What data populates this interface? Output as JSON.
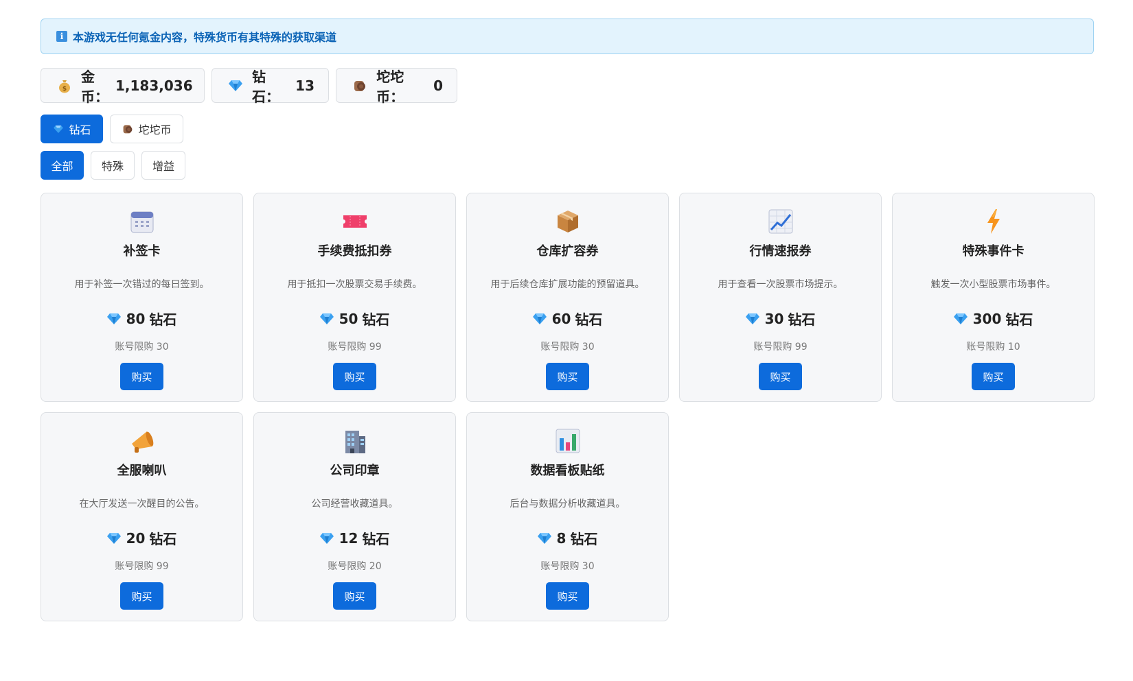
{
  "notice": {
    "text": "本游戏无任何氪金内容，特殊货币有其特殊的获取渠道",
    "icon": "info-icon"
  },
  "balances": [
    {
      "label": "金币：",
      "value": "1,183,036",
      "icon": "money-bag-icon"
    },
    {
      "label": "钻石：",
      "value": "13",
      "icon": "diamond-icon"
    },
    {
      "label": "坨坨币：",
      "value": "0",
      "icon": "tuotuo-coin-icon"
    }
  ],
  "currency_tabs": [
    {
      "label": "钻石",
      "icon": "diamond-icon",
      "active": true
    },
    {
      "label": "坨坨币",
      "icon": "tuotuo-coin-icon",
      "active": false
    }
  ],
  "category_tabs": [
    {
      "label": "全部",
      "active": true
    },
    {
      "label": "特殊",
      "active": false
    },
    {
      "label": "增益",
      "active": false
    }
  ],
  "items": [
    {
      "name": "补签卡",
      "desc": "用于补签一次错过的每日签到。",
      "price": "80",
      "unit": "钻石",
      "limit": "账号限购 30",
      "icon": "calendar-icon"
    },
    {
      "name": "手续费抵扣券",
      "desc": "用于抵扣一次股票交易手续费。",
      "price": "50",
      "unit": "钻石",
      "limit": "账号限购 99",
      "icon": "ticket-icon"
    },
    {
      "name": "仓库扩容券",
      "desc": "用于后续仓库扩展功能的预留道具。",
      "price": "60",
      "unit": "钻石",
      "limit": "账号限购 30",
      "icon": "package-icon"
    },
    {
      "name": "行情速报券",
      "desc": "用于查看一次股票市场提示。",
      "price": "30",
      "unit": "钻石",
      "limit": "账号限购 99",
      "icon": "chart-up-icon"
    },
    {
      "name": "特殊事件卡",
      "desc": "触发一次小型股票市场事件。",
      "price": "300",
      "unit": "钻石",
      "limit": "账号限购 10",
      "icon": "lightning-icon"
    },
    {
      "name": "全服喇叭",
      "desc": "在大厅发送一次醒目的公告。",
      "price": "20",
      "unit": "钻石",
      "limit": "账号限购 99",
      "icon": "megaphone-icon"
    },
    {
      "name": "公司印章",
      "desc": "公司经营收藏道具。",
      "price": "12",
      "unit": "钻石",
      "limit": "账号限购 20",
      "icon": "office-building-icon"
    },
    {
      "name": "数据看板贴纸",
      "desc": "后台与数据分析收藏道具。",
      "price": "8",
      "unit": "钻石",
      "limit": "账号限购 30",
      "icon": "bar-chart-icon"
    }
  ],
  "buy_label": "购买",
  "colors": {
    "primary": "#0d6bdc",
    "notice_bg": "#e3f3fd",
    "notice_text": "#0b63b6"
  }
}
